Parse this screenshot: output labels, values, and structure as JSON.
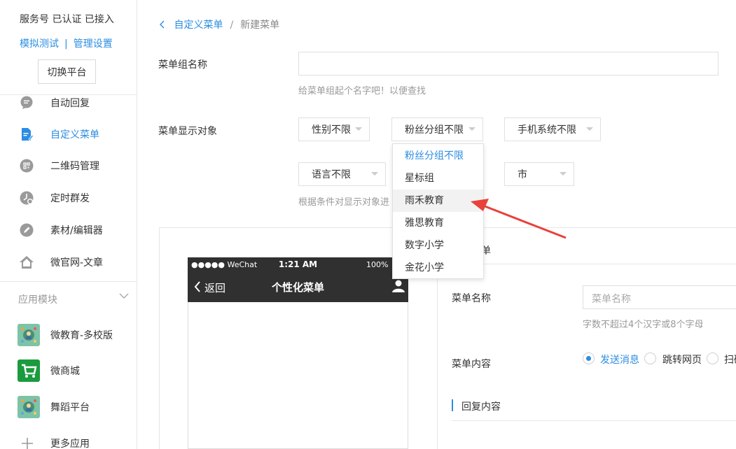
{
  "sidebar": {
    "account_status": "服务号 已认证 已接入",
    "links": [
      "模拟测试",
      "管理设置"
    ],
    "link_sep": "|",
    "switch_label": "切换平台",
    "items": [
      {
        "label": "自动回复",
        "icon": "chat-bubble-icon"
      },
      {
        "label": "自定义菜单",
        "icon": "document-edit-icon"
      },
      {
        "label": "二维码管理",
        "icon": "qrcode-icon"
      },
      {
        "label": "定时群发",
        "icon": "clock-icon"
      },
      {
        "label": "素材/编辑器",
        "icon": "pencil-icon"
      },
      {
        "label": "微官网-文章",
        "icon": "home-icon"
      }
    ],
    "section_title": "应用模块",
    "apps": [
      {
        "label": "微教育-多校版",
        "icon": "edu-app-icon"
      },
      {
        "label": "微商城",
        "icon": "shopping-cart-icon"
      },
      {
        "label": "舞蹈平台",
        "icon": "dance-app-icon"
      },
      {
        "label": "更多应用",
        "icon": "plus-icon"
      }
    ]
  },
  "breadcrumb": {
    "back_link": "自定义菜单",
    "separator": "/",
    "current": "新建菜单"
  },
  "form": {
    "group_name_label": "菜单组名称",
    "group_name_value": "",
    "group_name_hint": "给菜单组起个名字吧！以便查找",
    "target_label": "菜单显示对象",
    "selects": {
      "gender": "性别不限",
      "fan_group": "粉丝分组不限",
      "os": "手机系统不限",
      "language": "语言不限",
      "city": "市"
    },
    "target_hint": "根据条件对显示对象进",
    "fan_group_options": [
      "粉丝分组不限",
      "星标组",
      "雨禾教育",
      "雅思教育",
      "数字小学",
      "金花小学"
    ]
  },
  "phone": {
    "carrier": "●●●●● WeChat",
    "time": "1:21 AM",
    "battery": "100%",
    "back_label": "返回",
    "title": "个性化菜单"
  },
  "editor": {
    "header_partial": "单",
    "menu_name_label": "菜单名称",
    "menu_name_placeholder": "菜单名称",
    "menu_name_hint": "字数不超过4个汉字或8个字母",
    "menu_content_label": "菜单内容",
    "content_options": [
      "发送消息",
      "跳转网页",
      "扫码"
    ],
    "reply_title": "回复内容"
  },
  "colors": {
    "accent": "#2b8de2",
    "annotation_arrow": "#e8423a"
  }
}
